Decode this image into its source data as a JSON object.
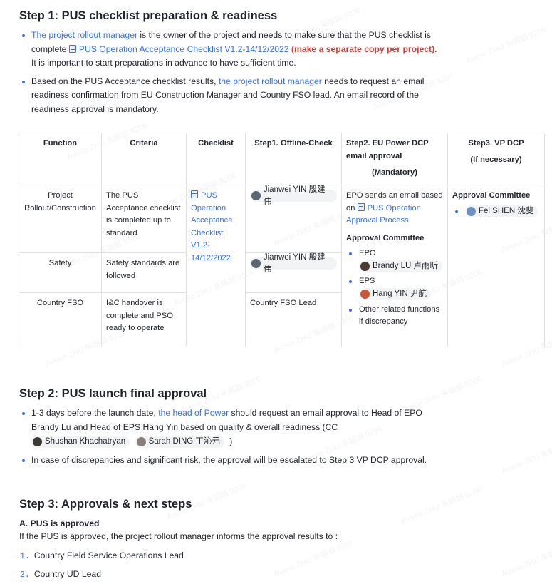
{
  "step1": {
    "heading": "Step 1: PUS checklist preparation & readiness",
    "b1": {
      "link1": "The project rollout manager",
      "text1": " is the owner of the project and needs to make sure that the PUS checklist is",
      "text2": "complete ",
      "doc_link": "PUS Operation Acceptance Checklist V1.2-14/12/2022",
      "red": "(make a separate copy per project)",
      "text3": ".",
      "text4": "It is important to start preparations in advance to have sufficient time."
    },
    "b2": {
      "text1": "Based on the PUS Acceptance checklist results, ",
      "link1": "the project rollout manager",
      "text2": " needs to request an email",
      "text3": "readiness confirmation from EU Construction Manager and Country FSO lead. An email record of the",
      "text4": "readiness approval is mandatory."
    }
  },
  "table": {
    "headers": {
      "function": "Function",
      "criteria": "Criteria",
      "checklist": "Checklist",
      "step1": "Step1. Offline-Check",
      "step2_line1": "Step2. EU Power DCP",
      "step2_line2": "email approval",
      "step2_line3": "(Mandatory)",
      "step3_line1": "Step3. VP DCP",
      "step3_line2": "(If necessary)"
    },
    "rows": [
      {
        "function": "Project Rollout/Construction",
        "criteria": "The PUS Acceptance checklist is completed up to standard",
        "step1": "Jianwei YIN 殷建伟"
      },
      {
        "function": "Safety",
        "criteria": "Safety standards are followed",
        "step1": "Jianwei YIN 殷建伟"
      },
      {
        "function": "Country FSO",
        "criteria": "I&C handover is complete and PSO ready to operate",
        "step1": "Country FSO Lead"
      }
    ],
    "checklist_link": "PUS Operation Acceptance Checklist V1.2-14/12/2022",
    "step2": {
      "text1": "EPO sends an email based on ",
      "link": "PUS Operation Approval Process",
      "committee": "Approval  Committee",
      "epo_label": "EPO",
      "epo_person": "Brandy LU 卢雨昕",
      "eps_label": "EPS",
      "eps_person": "Hang YIN 尹航",
      "other": "Other related functions if discrepancy"
    },
    "step3": {
      "committee": "Approval  Committee",
      "person": "Fei SHEN 沈斐"
    }
  },
  "step2": {
    "heading": "Step 2: PUS launch final approval",
    "b1": {
      "text1": "1-3 days before the launch date, ",
      "link": "the head of Power",
      "text2": " should request an email approval to Head of EPO",
      "text3": "Brandy Lu and Head of EPS Hang Yin  based on quality & overall readiness (CC",
      "person1": "Shushan Khachatryan",
      "person2": "Sarah DING 丁沁元",
      "close": ")"
    },
    "b2": "In case of discrepancies and significant risk, the approval will be escalated to Step 3 VP DCP approval."
  },
  "step3": {
    "heading": "Step 3: Approvals & next steps",
    "sub_heading": "A. PUS is approved",
    "intro": "If the PUS is approved, the project rollout manager informs the approval results to :",
    "items": [
      {
        "num": "1.",
        "text": "Country Field Service Operations Lead"
      },
      {
        "num": "2.",
        "text": "Country UD Lead"
      }
    ]
  },
  "watermark": "Avene ZHU 朱娟娟 9206",
  "colors": {
    "link": "#3370ff",
    "red": "#d83931",
    "border": "#dee0e3",
    "mention_bg": "#f2f3f5"
  }
}
